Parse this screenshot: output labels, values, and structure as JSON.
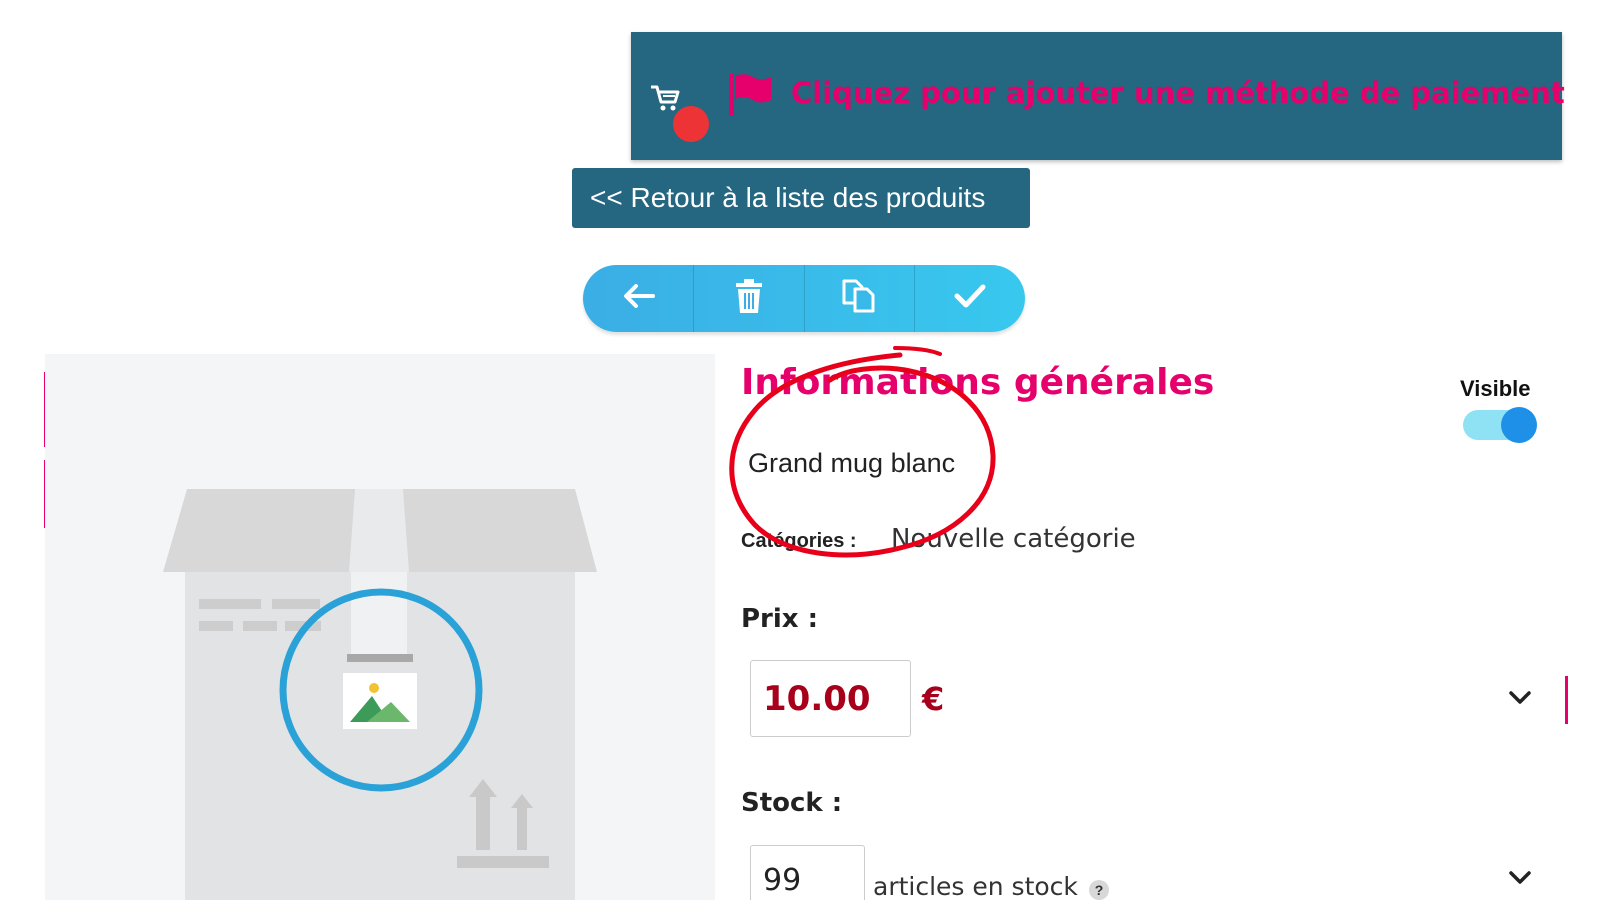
{
  "banner": {
    "text": "Cliquez pour ajouter une méthode de paiement",
    "icon": "cart-icon",
    "flag_icon": "flag-icon",
    "color_bg": "#256680",
    "color_text": "#e6006b"
  },
  "back_button": {
    "label": "<< Retour à la liste des produits"
  },
  "toolbar": {
    "buttons": [
      {
        "icon": "arrow-left-icon"
      },
      {
        "icon": "trash-icon"
      },
      {
        "icon": "copy-icon"
      },
      {
        "icon": "check-icon"
      }
    ]
  },
  "product": {
    "section_title": "Informations générales",
    "visible_label": "Visible",
    "visible": true,
    "name": "Grand mug blanc",
    "categories_label": "Catégories :",
    "categories_value": "Nouvelle catégorie",
    "price_label": "Prix :",
    "price_value": "10.00",
    "currency": "€",
    "stock_label": "Stock :",
    "stock_value": "99",
    "stock_suffix": "articles en stock",
    "help": "?"
  },
  "colors": {
    "accent": "#e6006b",
    "toolbar": "#38c8ee",
    "price": "#a8001b"
  }
}
